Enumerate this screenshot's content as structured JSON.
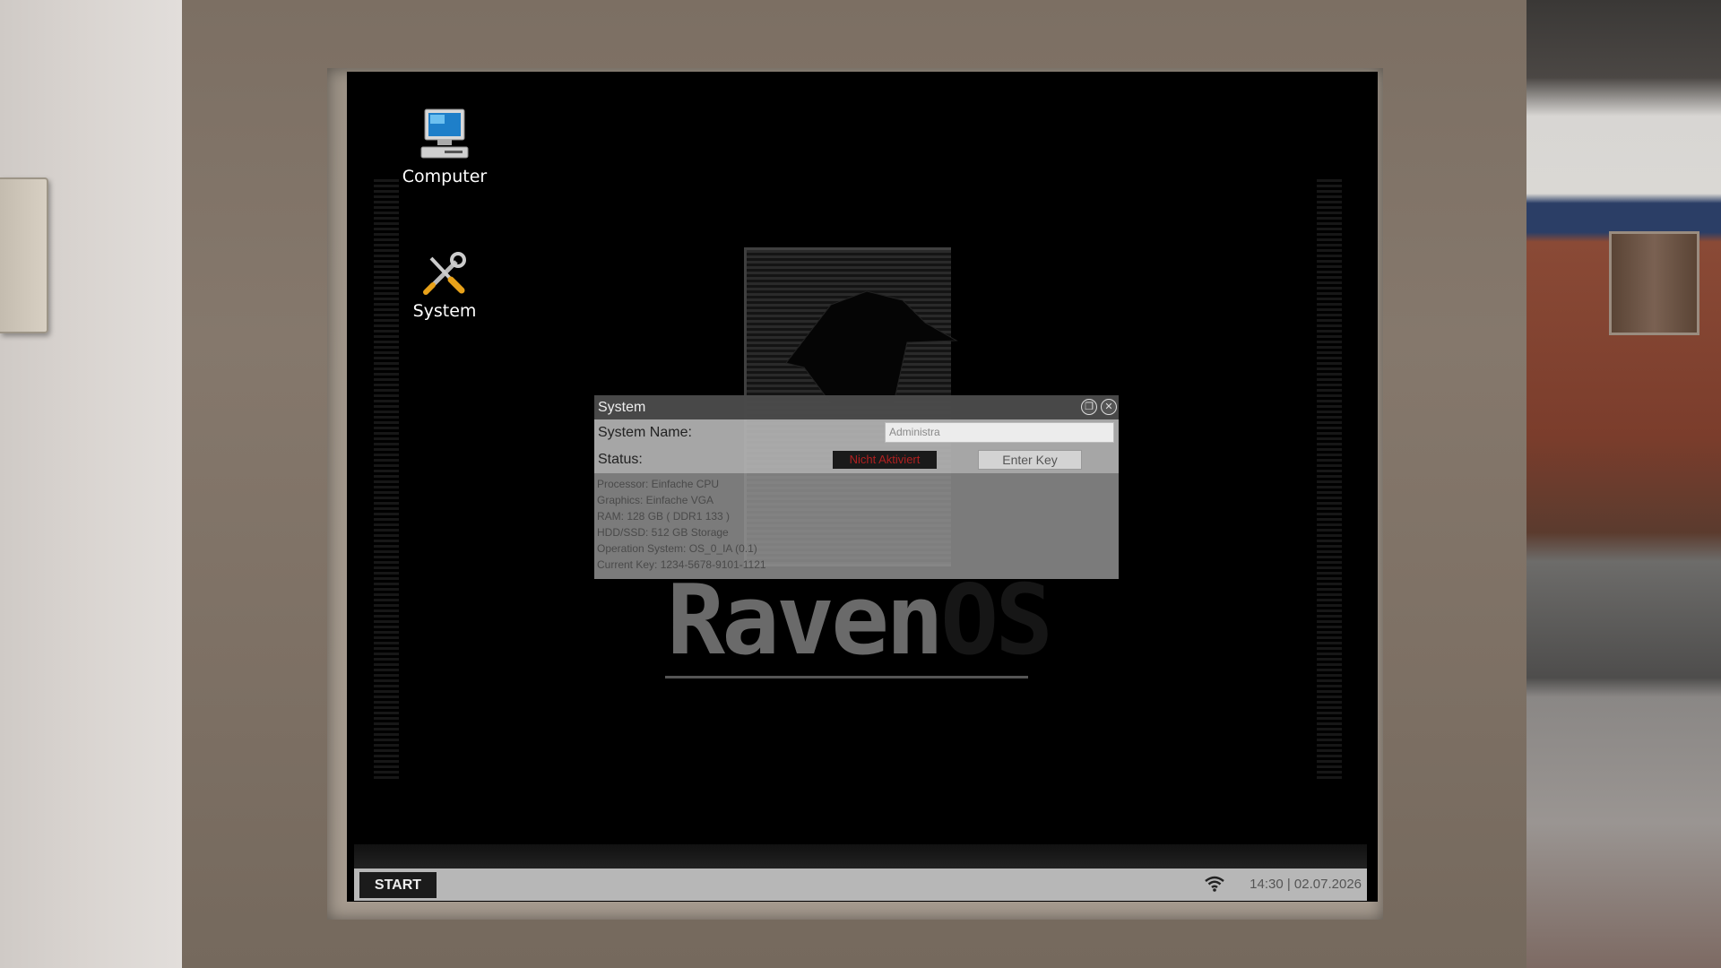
{
  "desktop": {
    "icons": [
      {
        "label": "Computer",
        "icon": "computer-icon"
      },
      {
        "label": "System",
        "icon": "tools-icon"
      }
    ],
    "logo": {
      "main": "Raven",
      "suffix": "OS"
    }
  },
  "system_window": {
    "title": "System",
    "name_label": "System Name:",
    "name_value": "Administra",
    "status_label": "Status:",
    "status_value": "Nicht Aktiviert",
    "enter_key_label": "Enter Key",
    "specs": [
      "Processor: Einfache CPU",
      "Graphics: Einfache VGA",
      "RAM: 128 GB ( DDR1 133 )",
      "HDD/SSD: 512 GB Storage",
      "Operation System: OS_0_IA (0.1)",
      "Current Key: 1234-5678-9101-1121"
    ]
  },
  "taskbar": {
    "start_label": "START",
    "clock": "14:30 | 02.07.2026",
    "wifi_icon": "wifi-icon"
  },
  "colors": {
    "status_error": "#b02020",
    "taskbar_bg": "#b7b7b7"
  }
}
